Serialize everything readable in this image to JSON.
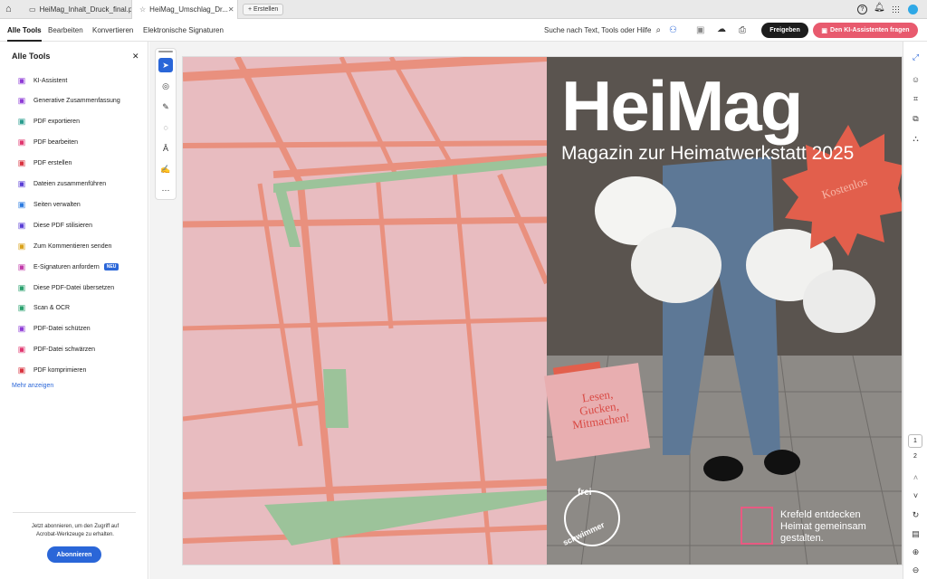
{
  "tabs": {
    "home_icon": "home-icon",
    "tab1": "HeiMag_Inhalt_Druck_final.pdf",
    "tab2": "HeiMag_Umschlag_Dr...",
    "new_tab": "+ Erstellen"
  },
  "menubar": {
    "items": [
      "Alle Tools",
      "Bearbeiten",
      "Konvertieren",
      "Elektronische Signaturen"
    ],
    "search": "Suche nach Text, Tools oder Hilfe",
    "share": "Freigeben",
    "ai": "Den KI-Assistenten fragen"
  },
  "panel": {
    "title": "Alle Tools",
    "items": [
      {
        "label": "KI-Assistent",
        "color": "#8f3cd6"
      },
      {
        "label": "Generative Zusammenfassung",
        "color": "#8f3cd6"
      },
      {
        "label": "PDF exportieren",
        "color": "#2a9d8f"
      },
      {
        "label": "PDF bearbeiten",
        "color": "#e0356e"
      },
      {
        "label": "PDF erstellen",
        "color": "#d9333f"
      },
      {
        "label": "Dateien zusammenführen",
        "color": "#5a3fd6"
      },
      {
        "label": "Seiten verwalten",
        "color": "#2c7be0"
      },
      {
        "label": "Diese PDF stilisieren",
        "color": "#5a3fd6"
      },
      {
        "label": "Zum Kommentieren senden",
        "color": "#d9a21a"
      },
      {
        "label": "E-Signaturen anfordern",
        "color": "#c13aa9",
        "badge": "NEU"
      },
      {
        "label": "Diese PDF-Datei übersetzen",
        "color": "#2aa16e"
      },
      {
        "label": "Scan & OCR",
        "color": "#2aa16e"
      },
      {
        "label": "PDF-Datei schützen",
        "color": "#8f3cd6"
      },
      {
        "label": "PDF-Datei schwärzen",
        "color": "#e0356e"
      },
      {
        "label": "PDF komprimieren",
        "color": "#d9333f"
      }
    ],
    "more": "Mehr anzeigen",
    "promo": "Jetzt abonnieren, um den Zugriff auf Acrobat-Werkzeuge zu erhalten.",
    "subscribe": "Abonnieren"
  },
  "cover": {
    "title": "HeiMag",
    "subtitle": "Magazin zur Heimatwerkstatt 2025",
    "badge": "Kostenlos",
    "note": "Lesen, Gucken, Mitmachen!",
    "logo_top": "frei",
    "logo_bottom": "schwimmer",
    "tagline1": "Krefeld entdecken",
    "tagline2": "Heimat gemeinsam",
    "tagline3": "gestalten."
  },
  "pager": {
    "current": "1",
    "next": "2"
  },
  "colors": {
    "map_bg": "#e8bcc0",
    "map_road": "#e9907e",
    "map_green": "#9cc39a",
    "accent": "#e25f4c",
    "brand": "#2a66d8"
  }
}
